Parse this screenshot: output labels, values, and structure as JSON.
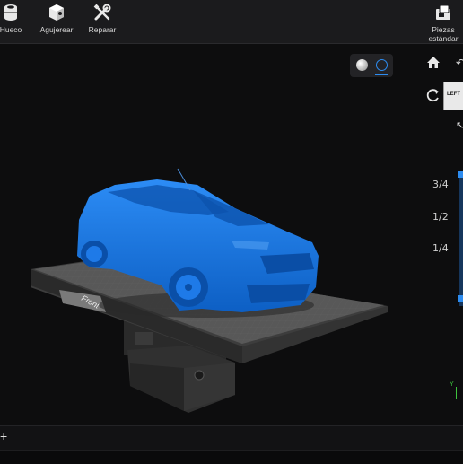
{
  "toolbar": {
    "hollow": {
      "label": "Hueco",
      "icon": "hollow-cylinder-icon"
    },
    "drill": {
      "label": "Agujerear",
      "icon": "drill-cube-icon"
    },
    "repair": {
      "label": "Reparar",
      "icon": "wrench-screwdriver-icon"
    },
    "standard_parts": {
      "label": "Piezas estándar",
      "icon": "parts-box-icon"
    }
  },
  "viewport": {
    "shading_modes": [
      "solid-sphere-icon",
      "xray-sphere-icon"
    ],
    "active_shading": "xray-sphere-icon",
    "plate_label": "Front",
    "model_color": "#1677e6",
    "accent": "#2d8cf0"
  },
  "view_cube": {
    "face": "LEFT"
  },
  "side_controls": {
    "home_icon": "home-icon",
    "rotate_icon": "rotate-view-icon"
  },
  "slider": {
    "marks": [
      "3/4",
      "1/2",
      "1/4"
    ]
  },
  "axis": {
    "y_label": "Y"
  },
  "bottom": {
    "add_label": "+"
  }
}
